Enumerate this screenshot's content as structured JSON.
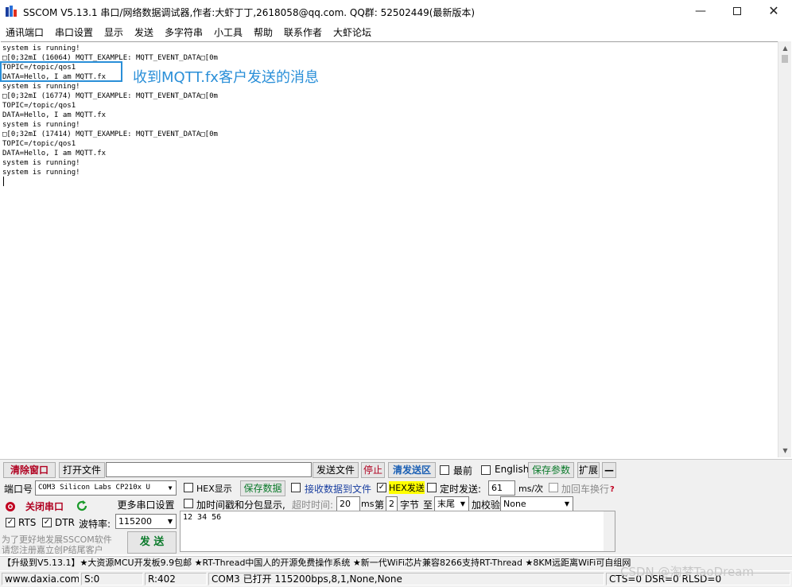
{
  "window": {
    "title": "SSCOM V5.13.1 串口/网络数据调试器,作者:大虾丁丁,2618058@qq.com. QQ群: 52502449(最新版本)",
    "minimize": "—",
    "close": "✕"
  },
  "menu": [
    "通讯端口",
    "串口设置",
    "显示",
    "发送",
    "多字符串",
    "小工具",
    "帮助",
    "联系作者",
    "大虾论坛"
  ],
  "terminal": {
    "lines": [
      "system is running!",
      "□[0;32mI (16064) MQTT_EXAMPLE: MQTT_EVENT_DATA□[0m",
      "TOPIC=/topic/qos1",
      "DATA=Hello, I am MQTT.fx",
      "system is running!",
      "□[0;32mI (16774) MQTT_EXAMPLE: MQTT_EVENT_DATA□[0m",
      "TOPIC=/topic/qos1",
      "DATA=Hello, I am MQTT.fx",
      "system is running!",
      "□[0;32mI (17414) MQTT_EXAMPLE: MQTT_EVENT_DATA□[0m",
      "TOPIC=/topic/qos1",
      "DATA=Hello, I am MQTT.fx",
      "system is running!",
      "system is running!"
    ]
  },
  "annotation": "收到MQTT.fx客户发送的消息",
  "toolbar": {
    "clear": "清除窗口",
    "open_file": "打开文件",
    "file_path": "",
    "send_file": "发送文件",
    "stop": "停止",
    "clear_send": "清发送区",
    "topmost": "最前",
    "english": "English",
    "save_params": "保存参数",
    "expand": "扩展",
    "collapse": "—"
  },
  "port": {
    "port_label": "端口号",
    "port_value": "COM3 Silicon Labs CP210x U",
    "close_port": "关闭串口",
    "more_settings": "更多串口设置",
    "rts": "RTS",
    "dtr": "DTR",
    "baud_label": "波特率:",
    "baud_value": "115200",
    "promo_line1": "为了更好地发展SSCOM软件",
    "promo_line2": "请您注册嘉立创P结尾客户",
    "send": "发 送"
  },
  "options": {
    "hex_display": "HEX显示",
    "save_data": "保存数据",
    "recv_to_file": "接收数据到文件",
    "hex_send": "HEX发送",
    "timed_send": "定时发送:",
    "timed_value": "61",
    "ms_per": "ms/次",
    "add_crlf": "加回车换行",
    "timestamp": "加时间戳和分包显示,",
    "timeout_label": "超时时间:",
    "timeout_value": "20",
    "ms": "ms",
    "nth": "第",
    "byte_value": "2",
    "byte_label": "字节",
    "to": "至",
    "end_value": "末尾",
    "checksum_label": "加校验",
    "checksum_value": "None",
    "help_mark": "?"
  },
  "send_area": {
    "content": "12 34 56"
  },
  "adbar": "【升级到V5.13.1】★大资源MCU开发板9.9包邮 ★RT-Thread中国人的开源免费操作系统 ★新一代WiFi芯片兼容8266支持RT-Thread ★8KM远距离WiFi可自组网",
  "status": {
    "website": "www.daxia.com",
    "sent": "S:0",
    "received": "R:402",
    "port_status": "COM3 已打开  115200bps,8,1,None,None",
    "lines": "CTS=0 DSR=0 RLSD=0"
  },
  "watermark": "CSDN @淘梦TaoDream",
  "colors": {
    "annotation": "#2a8fd8",
    "hex_highlight": "#ffff00",
    "clear_button": "#b00020",
    "save_button": "#0a7a2a"
  }
}
